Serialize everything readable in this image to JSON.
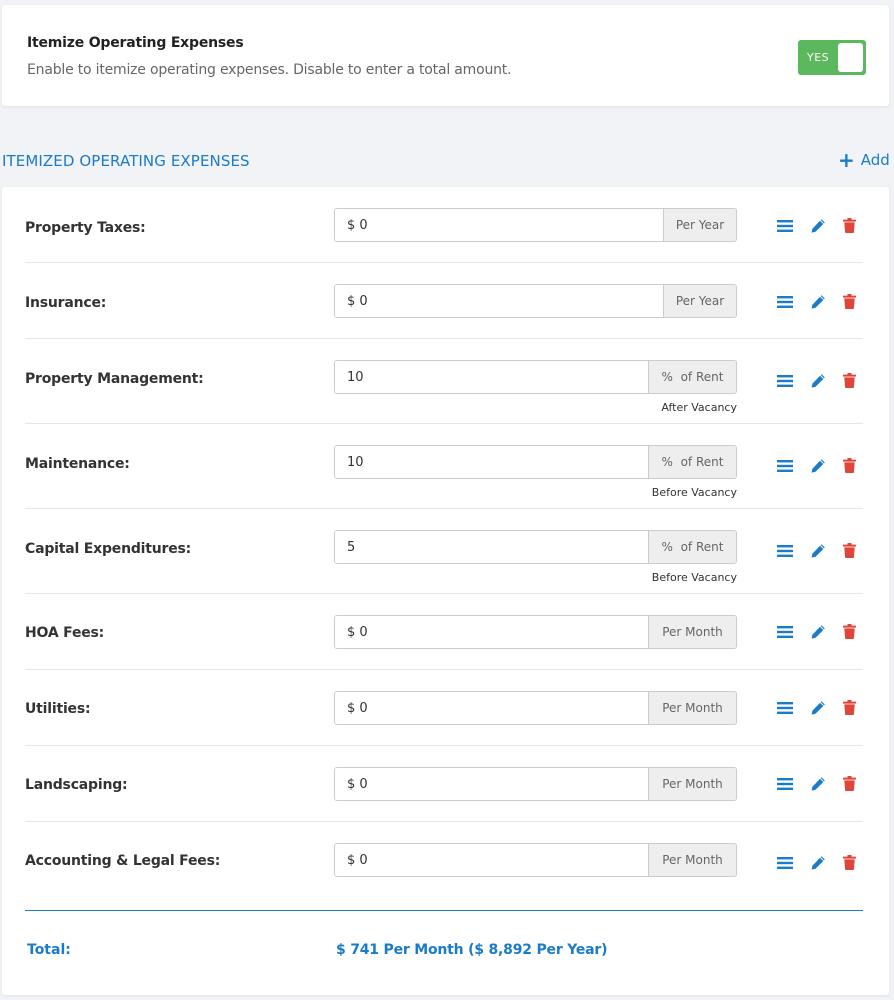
{
  "itemize": {
    "title": "Itemize Operating Expenses",
    "description": "Enable to itemize operating expenses. Disable to enter a total amount.",
    "toggle_label": "YES",
    "enabled": true
  },
  "section": {
    "title": "ITEMIZED OPERATING EXPENSES",
    "add_label": "Add"
  },
  "expenses": [
    {
      "label": "Property Taxes:",
      "value": "$ 0",
      "unit": "Per Year",
      "note": ""
    },
    {
      "label": "Insurance:",
      "value": "$ 0",
      "unit": "Per Year",
      "note": ""
    },
    {
      "label": "Property Management:",
      "value": "10",
      "unit": "%  of Rent",
      "note": "After Vacancy"
    },
    {
      "label": "Maintenance:",
      "value": "10",
      "unit": "%  of Rent",
      "note": "Before Vacancy"
    },
    {
      "label": "Capital Expenditures:",
      "value": "5",
      "unit": "%  of Rent",
      "note": "Before Vacancy"
    },
    {
      "label": "HOA Fees:",
      "value": "$ 0",
      "unit": "Per Month",
      "note": ""
    },
    {
      "label": "Utilities:",
      "value": "$ 0",
      "unit": "Per Month",
      "note": ""
    },
    {
      "label": "Landscaping:",
      "value": "$ 0",
      "unit": "Per Month",
      "note": ""
    },
    {
      "label": "Accounting & Legal Fees:",
      "value": "$ 0",
      "unit": "Per Month",
      "note": ""
    }
  ],
  "icons": {
    "menu": "menu-icon",
    "edit": "pencil-icon",
    "delete": "trash-icon"
  },
  "total": {
    "label": "Total:",
    "value": "$ 741 Per Month  ($ 8,892 Per Year)"
  },
  "colors": {
    "accent": "#1a7bc9",
    "toggle_on": "#5cb85c",
    "delete": "#e0453a"
  }
}
